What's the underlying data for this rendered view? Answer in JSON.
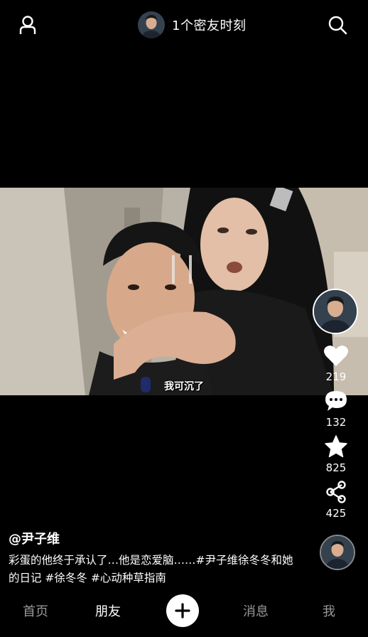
{
  "top_bar": {
    "profile_icon": "person-outline-icon",
    "friend_moments_text": "1个密友时刻",
    "search_icon": "search-icon"
  },
  "video": {
    "subtitle": "我可沉了"
  },
  "actions": {
    "like_count": "219",
    "comment_count": "132",
    "favorite_count": "825",
    "share_count": "425",
    "like_icon": "heart-icon",
    "comment_icon": "comment-bubble-icon",
    "favorite_icon": "star-icon",
    "share_icon": "share-icon"
  },
  "caption": {
    "username": "@尹子维",
    "description": "彩蛋的他终于承认了…他是恋爱脑……#尹子维徐冬冬和她的日记 #徐冬冬 #心动种草指南"
  },
  "bottom_nav": {
    "home": "首页",
    "friends": "朋友",
    "add_icon": "plus-icon",
    "messages": "消息",
    "me": "我",
    "active_tab": "朋友"
  }
}
